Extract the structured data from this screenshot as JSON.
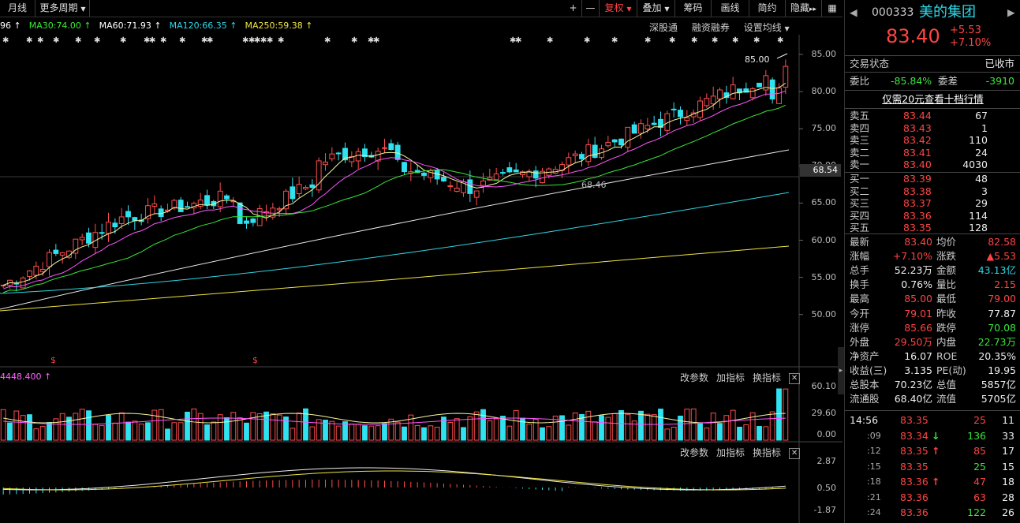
{
  "toolbar": {
    "left": [
      {
        "label": "月线"
      },
      {
        "label": "更多周期"
      }
    ],
    "plus": "+",
    "minus": "—",
    "right": [
      {
        "label": "复权"
      },
      {
        "label": "叠加"
      },
      {
        "label": "筹码"
      },
      {
        "label": "画线"
      },
      {
        "label": "简约"
      },
      {
        "label": "隐藏"
      }
    ],
    "more": "▸▸",
    "grid_icon": "grid-icon"
  },
  "ma_legend": [
    {
      "text": "96 ↑",
      "color": "#ffffff"
    },
    {
      "text": "MA30:74.00 ↑",
      "color": "#39e639"
    },
    {
      "text": "MA60:71.93 ↑",
      "color": "#ffffff"
    },
    {
      "text": "MA120:66.35 ↑",
      "color": "#2fd6e6"
    },
    {
      "text": "MA250:59.38 ↑",
      "color": "#f0e442"
    }
  ],
  "chart_tools": {
    "a": "深股通",
    "b": "融资融券",
    "c": "设置均线"
  },
  "price_axis": [
    "85.00",
    "80.00",
    "75.00",
    "70.00",
    "65.00",
    "60.00",
    "55.00",
    "50.00"
  ],
  "current_tag": "68.54",
  "high_label": "85.00",
  "low_label": "68.46",
  "dollar": "$",
  "vol": {
    "title": "4448.400 ↑",
    "axis": [
      "60.10",
      "29.60",
      "0.00"
    ],
    "btns": [
      "改参数",
      "加指标",
      "换指标"
    ]
  },
  "macd": {
    "axis": [
      "2.87",
      "0.50",
      "-1.87"
    ],
    "btns": [
      "改参数",
      "加指标",
      "换指标"
    ]
  },
  "quote": {
    "code": "000333",
    "name": "美的集团",
    "price": "83.40",
    "change": "+5.53",
    "change_pct": "+7.10%",
    "status_label": "交易状态",
    "status": "已收市",
    "wb_label": "委比",
    "wb": "-85.84%",
    "wc_label": "委差",
    "wc": "-3910",
    "promo": "仅需20元查看十档行情",
    "asks": [
      {
        "label": "卖五",
        "price": "83.44",
        "vol": "67"
      },
      {
        "label": "卖四",
        "price": "83.43",
        "vol": "1"
      },
      {
        "label": "卖三",
        "price": "83.42",
        "vol": "110"
      },
      {
        "label": "卖二",
        "price": "83.41",
        "vol": "24"
      },
      {
        "label": "卖一",
        "price": "83.40",
        "vol": "4030"
      }
    ],
    "bids": [
      {
        "label": "买一",
        "price": "83.39",
        "vol": "48"
      },
      {
        "label": "买二",
        "price": "83.38",
        "vol": "3"
      },
      {
        "label": "买三",
        "price": "83.37",
        "vol": "29"
      },
      {
        "label": "买四",
        "price": "83.36",
        "vol": "114"
      },
      {
        "label": "买五",
        "price": "83.35",
        "vol": "128"
      }
    ],
    "stats": [
      {
        "l1": "最新",
        "v1": "83.40",
        "c1": "#ff4444",
        "l2": "均价",
        "v2": "82.58",
        "c2": "#ff4444"
      },
      {
        "l1": "涨幅",
        "v1": "+7.10%",
        "c1": "#ff4444",
        "l2": "涨跌",
        "v2": "▲5.53",
        "c2": "#ff4444"
      },
      {
        "l1": "总手",
        "v1": "52.23万",
        "c1": "#eeeeee",
        "l2": "金额",
        "v2": "43.13亿",
        "c2": "#2fd6e6"
      },
      {
        "l1": "换手",
        "v1": "0.76%",
        "c1": "#eeeeee",
        "l2": "量比",
        "v2": "2.15",
        "c2": "#ff4444"
      },
      {
        "l1": "最高",
        "v1": "85.00",
        "c1": "#ff4444",
        "l2": "最低",
        "v2": "79.00",
        "c2": "#ff4444"
      },
      {
        "l1": "今开",
        "v1": "79.01",
        "c1": "#ff4444",
        "l2": "昨收",
        "v2": "77.87",
        "c2": "#eeeeee"
      },
      {
        "l1": "涨停",
        "v1": "85.66",
        "c1": "#ff4444",
        "l2": "跌停",
        "v2": "70.08",
        "c2": "#39e639"
      },
      {
        "l1": "外盘",
        "v1": "29.50万",
        "c1": "#ff4444",
        "l2": "内盘",
        "v2": "22.73万",
        "c2": "#39e639"
      },
      {
        "l1": "净资产",
        "v1": "16.07",
        "c1": "#eeeeee",
        "l2": "ROE",
        "v2": "20.35%",
        "c2": "#eeeeee"
      },
      {
        "l1": "收益(三)",
        "v1": "3.135",
        "c1": "#eeeeee",
        "l2": "PE(动)",
        "v2": "19.95",
        "c2": "#eeeeee"
      },
      {
        "l1": "总股本",
        "v1": "70.23亿",
        "c1": "#eeeeee",
        "l2": "总值",
        "v2": "5857亿",
        "c2": "#eeeeee"
      },
      {
        "l1": "流通股",
        "v1": "68.40亿",
        "c1": "#eeeeee",
        "l2": "流值",
        "v2": "5705亿",
        "c2": "#eeeeee"
      }
    ],
    "ticks": [
      {
        "t": "14:56",
        "p": "83.35",
        "a": "",
        "v": "25",
        "n": "11",
        "vc": "#ff4444"
      },
      {
        "t": ":09",
        "p": "83.34",
        "a": "↓",
        "v": "136",
        "n": "33",
        "vc": "#39e639"
      },
      {
        "t": ":12",
        "p": "83.35",
        "a": "↑",
        "v": "85",
        "n": "17",
        "vc": "#ff4444"
      },
      {
        "t": ":15",
        "p": "83.35",
        "a": "",
        "v": "25",
        "n": "15",
        "vc": "#39e639"
      },
      {
        "t": ":18",
        "p": "83.36",
        "a": "↑",
        "v": "47",
        "n": "18",
        "vc": "#ff4444"
      },
      {
        "t": ":21",
        "p": "83.36",
        "a": "",
        "v": "63",
        "n": "28",
        "vc": "#ff4444"
      },
      {
        "t": ":24",
        "p": "83.36",
        "a": "",
        "v": "122",
        "n": "26",
        "vc": "#39e639"
      }
    ]
  }
}
